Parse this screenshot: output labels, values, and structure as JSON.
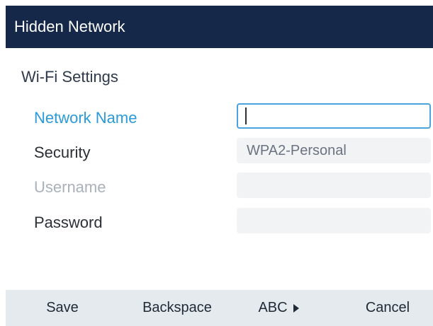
{
  "window": {
    "title": "Hidden Network"
  },
  "section": {
    "title": "Wi-Fi Settings"
  },
  "form": {
    "network_name": {
      "label": "Network Name",
      "value": ""
    },
    "security": {
      "label": "Security",
      "value": "WPA2-Personal"
    },
    "username": {
      "label": "Username",
      "value": ""
    },
    "password": {
      "label": "Password",
      "value": ""
    }
  },
  "softkeys": {
    "save": "Save",
    "backspace": "Backspace",
    "abc": "ABC",
    "cancel": "Cancel"
  },
  "colors": {
    "titlebar": "#15284a",
    "active_label": "#2b9ad8",
    "disabled_label": "#a9b1ba",
    "softkey_bar": "#e4eaee"
  }
}
